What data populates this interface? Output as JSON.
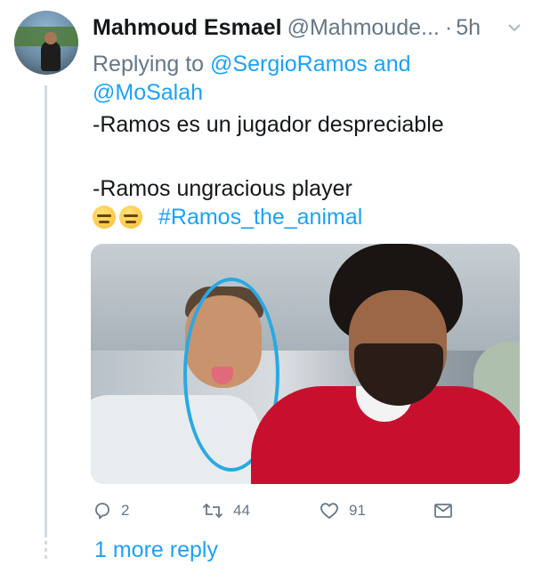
{
  "tweet": {
    "author_name": "Mahmoud Esmael",
    "author_handle": "@Mahmoude...",
    "separator": "·",
    "time": "5h",
    "replying_prefix": "Replying to",
    "replying_to": "@SergioRamos and @MoSalah",
    "text_line1": "-Ramos es un jugador despreciable",
    "text_line2": "-Ramos ungracious player",
    "hashtag": "#Ramos_the_animal"
  },
  "actions": {
    "reply_count": "2",
    "retweet_count": "44",
    "like_count": "91"
  },
  "more_replies_label": "1 more reply",
  "icons": {
    "reply": "reply-icon",
    "retweet": "retweet-icon",
    "like": "heart-icon",
    "share": "envelope-icon",
    "menu": "chevron-down-icon"
  },
  "colors": {
    "link": "#1da1f2",
    "secondary_text": "#657786",
    "primary_text": "#14171a",
    "annotation_circle": "#29a9e1"
  }
}
